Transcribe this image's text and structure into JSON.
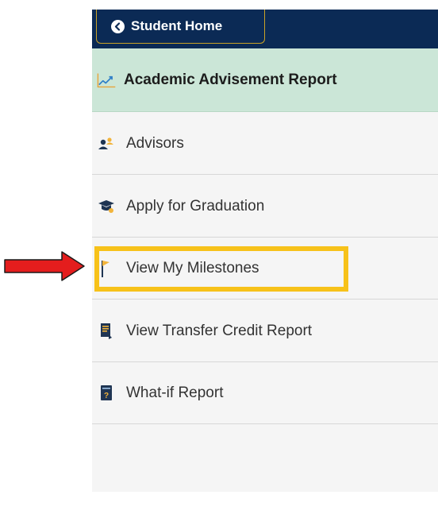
{
  "header": {
    "back_label": "Student Home"
  },
  "menu": {
    "items": [
      {
        "label": "Academic Advisement Report",
        "icon": "chart-line-icon",
        "active": true
      },
      {
        "label": "Advisors",
        "icon": "advisors-icon"
      },
      {
        "label": "Apply for Graduation",
        "icon": "graduation-cap-icon"
      },
      {
        "label": "View My Milestones",
        "icon": "flag-icon",
        "highlighted": true
      },
      {
        "label": "View Transfer Credit Report",
        "icon": "transfer-report-icon"
      },
      {
        "label": "What-if Report",
        "icon": "what-if-report-icon"
      }
    ]
  },
  "colors": {
    "topbar": "#0b2a55",
    "active_bg": "#cbe6d7",
    "highlight_border": "#f7c21a",
    "arrow": "#e41d1d"
  }
}
